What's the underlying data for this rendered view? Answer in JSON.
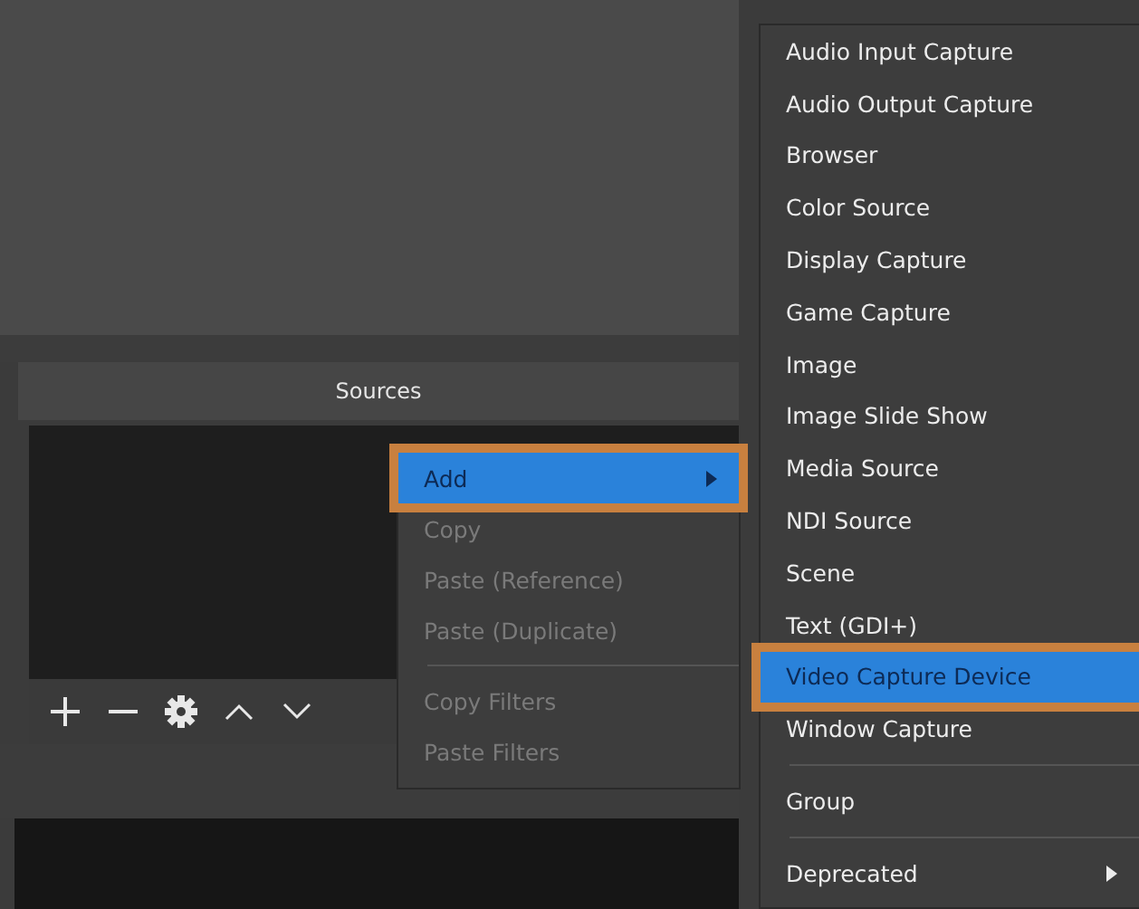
{
  "sources_dock": {
    "title": "Sources"
  },
  "context_menu": {
    "items": [
      {
        "label": "Add",
        "selected": true,
        "disabled": false,
        "submenu": true,
        "separator_above": false
      },
      {
        "label": "Copy",
        "selected": false,
        "disabled": true,
        "submenu": false,
        "separator_above": false
      },
      {
        "label": "Paste (Reference)",
        "selected": false,
        "disabled": true,
        "submenu": false,
        "separator_above": false
      },
      {
        "label": "Paste (Duplicate)",
        "selected": false,
        "disabled": true,
        "submenu": false,
        "separator_above": false
      },
      {
        "label": "Copy Filters",
        "selected": false,
        "disabled": true,
        "submenu": false,
        "separator_above": true
      },
      {
        "label": "Paste Filters",
        "selected": false,
        "disabled": true,
        "submenu": false,
        "separator_above": false
      }
    ]
  },
  "add_submenu": {
    "items": [
      {
        "label": "Audio Input Capture",
        "selected": false,
        "submenu": false,
        "separator_above": false
      },
      {
        "label": "Audio Output Capture",
        "selected": false,
        "submenu": false,
        "separator_above": false
      },
      {
        "label": "Browser",
        "selected": false,
        "submenu": false,
        "separator_above": false
      },
      {
        "label": "Color Source",
        "selected": false,
        "submenu": false,
        "separator_above": false
      },
      {
        "label": "Display Capture",
        "selected": false,
        "submenu": false,
        "separator_above": false
      },
      {
        "label": "Game Capture",
        "selected": false,
        "submenu": false,
        "separator_above": false
      },
      {
        "label": "Image",
        "selected": false,
        "submenu": false,
        "separator_above": false
      },
      {
        "label": "Image Slide Show",
        "selected": false,
        "submenu": false,
        "separator_above": false
      },
      {
        "label": "Media Source",
        "selected": false,
        "submenu": false,
        "separator_above": false
      },
      {
        "label": "NDI Source",
        "selected": false,
        "submenu": false,
        "separator_above": false
      },
      {
        "label": "Scene",
        "selected": false,
        "submenu": false,
        "separator_above": false
      },
      {
        "label": "Text (GDI+)",
        "selected": false,
        "submenu": false,
        "separator_above": false
      },
      {
        "label": "Video Capture Device",
        "selected": true,
        "submenu": false,
        "separator_above": false
      },
      {
        "label": "Window Capture",
        "selected": false,
        "submenu": false,
        "separator_above": false
      },
      {
        "label": "Group",
        "selected": false,
        "submenu": false,
        "separator_above": true
      },
      {
        "label": "Deprecated",
        "selected": false,
        "submenu": true,
        "separator_above": true
      }
    ]
  }
}
